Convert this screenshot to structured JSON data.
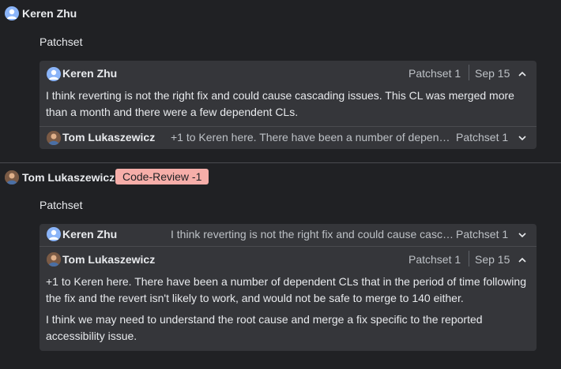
{
  "thread1": {
    "author": "Keren Zhu",
    "label": "Patchset",
    "comments": [
      {
        "author": "Keren Zhu",
        "patchset": "Patchset 1",
        "date": "Sep 15",
        "text": "I think reverting is not the right fix and could cause cascading issues. This CL was merged more than a month and there were a few dependent CLs."
      },
      {
        "author": "Tom Lukaszewicz",
        "summary": "+1 to Keren here. There have been a number of depende…",
        "patchset": "Patchset 1"
      }
    ]
  },
  "thread2": {
    "author": "Tom Lukaszewicz",
    "vote": "Code-Review -1",
    "label": "Patchset",
    "comments": [
      {
        "author": "Keren Zhu",
        "summary": "I think reverting is not the right fix and could cause casc…",
        "patchset": "Patchset 1"
      },
      {
        "author": "Tom Lukaszewicz",
        "patchset": "Patchset 1",
        "date": "Sep 15",
        "paragraph1": "+1 to Keren here. There have been a number of dependent CLs that in the period of time following the fix and the revert isn't likely to work, and would not be safe to merge to 140 either.",
        "paragraph2": "I think we may need to understand the root cause and merge a fix specific to the reported accessibility issue."
      }
    ]
  },
  "colors": {
    "background": "#202124",
    "card": "#35363a",
    "badge": "#f6aea9",
    "avatar_default": "#8ab4f8"
  },
  "icons": [
    "person-avatar-icon",
    "chevron-up-icon",
    "chevron-down-icon"
  ]
}
